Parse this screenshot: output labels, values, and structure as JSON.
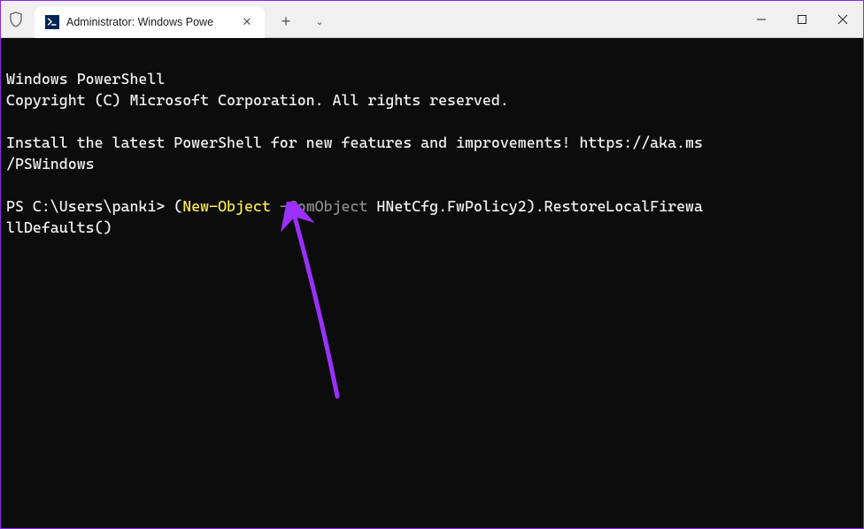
{
  "titlebar": {
    "tab_title": "Administrator: Windows Powe",
    "tab_icon_glyph": ">_",
    "new_tab_glyph": "+",
    "dropdown_glyph": "⌄",
    "minimize_glyph": "—",
    "maximize_glyph": "☐",
    "close_glyph": "✕",
    "tab_close_glyph": "✕"
  },
  "terminal": {
    "line1": "Windows PowerShell",
    "line2": "Copyright (C) Microsoft Corporation. All rights reserved.",
    "line_spacer": "",
    "line3a": "Install the latest PowerShell for new features and improvements! https://aka.ms",
    "line3b": "/PSWindows",
    "prompt": "PS C:\\Users\\panki> ",
    "cmd_paren_open": "(",
    "cmd_newobject": "New-Object",
    "cmd_space1": " ",
    "cmd_comobject": "-ComObject",
    "cmd_space2": " ",
    "cmd_hnet": "HNetCfg.FwPolicy2",
    "cmd_paren_close": ")",
    "cmd_dot": ".",
    "cmd_restore_part1": "RestoreLocalFirewa",
    "cmd_restore_part2": "llDefaults()"
  },
  "annotation": {
    "color": "#9b30ff"
  }
}
